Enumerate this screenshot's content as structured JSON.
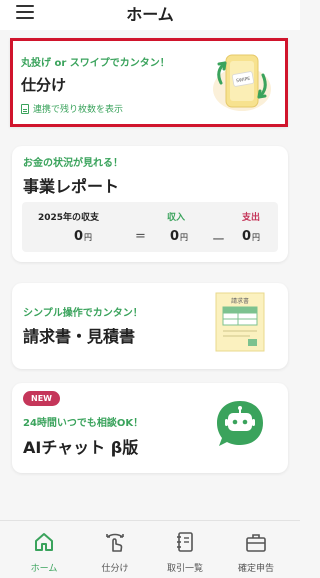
{
  "header": {
    "title": "ホーム"
  },
  "shiwake_card": {
    "eyebrow": "丸投げ or スワイプでカンタン！",
    "title": "仕分け",
    "link": "連携で残り枚数を表示",
    "illustration_text": "SWIPE"
  },
  "report_card": {
    "eyebrow": "お金の状況が見れる！",
    "title": "事業レポート",
    "year_label": "2025年の収支",
    "income_label": "収入",
    "expense_label": "支出",
    "balance": "0",
    "income": "0",
    "expense": "0",
    "unit": "円",
    "eq": "=",
    "minus": "ー"
  },
  "invoice_card": {
    "eyebrow": "シンプル操作でカンタン！",
    "title": "請求書・見積書",
    "illustration_text": "請求書"
  },
  "ai_card": {
    "badge": "NEW",
    "eyebrow": "24時間いつでも相談OK！",
    "title": "AIチャット β版"
  },
  "bottom_nav": {
    "items": [
      {
        "label": "ホーム",
        "icon": "home-icon",
        "active": true
      },
      {
        "label": "仕分け",
        "icon": "swipe-hand-icon",
        "active": false
      },
      {
        "label": "取引一覧",
        "icon": "notebook-icon",
        "active": false
      },
      {
        "label": "確定申告",
        "icon": "briefcase-icon",
        "active": false
      }
    ]
  },
  "colors": {
    "accent_green": "#3aa35c",
    "highlight_red": "#d0142c",
    "expense_pink": "#c5365a",
    "background": "#f6f6f6"
  }
}
